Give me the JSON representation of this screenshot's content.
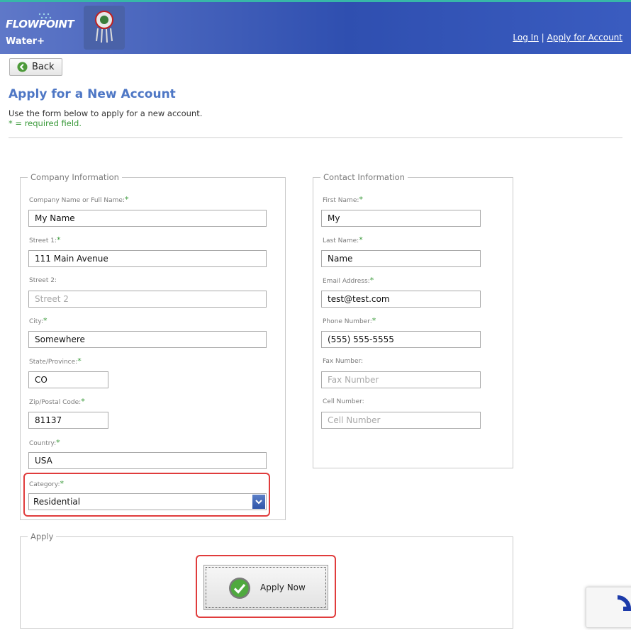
{
  "header": {
    "logo_flowpoint": "FLOWPOINT",
    "logo_water": "Water+",
    "login_link": "Log In",
    "separator": "|",
    "apply_link": "Apply for Account",
    "emblem_icon": "dreamcatcher-emblem-icon"
  },
  "toolbar": {
    "back_label": "Back",
    "back_icon": "back-arrow-icon"
  },
  "page": {
    "title": "Apply for a New Account",
    "intro": "Use the form below to apply for a new account.",
    "required_note": "* = required field."
  },
  "company": {
    "legend": "Company Information",
    "fields": {
      "name": {
        "label": "Company Name or Full Name:",
        "value": "My Name"
      },
      "street1": {
        "label": "Street 1:",
        "value": "111 Main Avenue"
      },
      "street2": {
        "label": "Street 2:",
        "value": "",
        "placeholder": "Street 2"
      },
      "city": {
        "label": "City:",
        "value": "Somewhere"
      },
      "state": {
        "label": "State/Province:",
        "value": "CO"
      },
      "zip": {
        "label": "Zip/Postal Code:",
        "value": "81137"
      },
      "country": {
        "label": "Country:",
        "value": "USA"
      },
      "category": {
        "label": "Category:",
        "value": "Residential"
      }
    }
  },
  "contact": {
    "legend": "Contact Information",
    "fields": {
      "first": {
        "label": "First Name:",
        "value": "My"
      },
      "last": {
        "label": "Last Name:",
        "value": "Name"
      },
      "email": {
        "label": "Email Address:",
        "value": "test@test.com"
      },
      "phone": {
        "label": "Phone Number:",
        "value": "(555) 555-5555"
      },
      "fax": {
        "label": "Fax Number:",
        "value": "",
        "placeholder": "Fax Number"
      },
      "cell": {
        "label": "Cell Number:",
        "value": "",
        "placeholder": "Cell Number"
      }
    }
  },
  "apply": {
    "legend": "Apply",
    "button_label": "Apply Now",
    "button_icon": "green-checkmark-icon"
  },
  "colors": {
    "header_blue": "#3a5cc0",
    "title_blue": "#4e77c5",
    "required_green": "#3a9a3a",
    "highlight_red": "#e03c3c"
  }
}
